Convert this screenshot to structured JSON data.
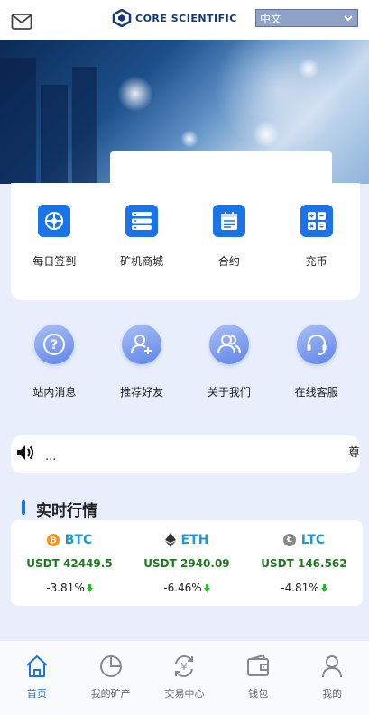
{
  "header": {
    "brand": "CORE SCIENTIFIC",
    "language": "中文",
    "icons": {
      "mail": "mail-icon",
      "logo": "core-scientific-logo"
    }
  },
  "quick_menu": [
    {
      "label": "每日签到",
      "icon": "sign-in-icon"
    },
    {
      "label": "矿机商城",
      "icon": "server-icon"
    },
    {
      "label": "合约",
      "icon": "contract-icon"
    },
    {
      "label": "充币",
      "icon": "calculator-icon"
    }
  ],
  "secondary_menu": [
    {
      "label": "站内消息",
      "icon": "question-icon"
    },
    {
      "label": "推荐好友",
      "icon": "add-user-icon"
    },
    {
      "label": "关于我们",
      "icon": "users-icon"
    },
    {
      "label": "在线客服",
      "icon": "headset-icon"
    }
  ],
  "notice": {
    "ellipsis": "...",
    "text": "尊敬"
  },
  "market": {
    "title": "实时行情",
    "coins": [
      {
        "symbol": "BTC",
        "price": "USDT 42449.5",
        "change": "-3.81%",
        "coin_color": "#f7931a",
        "icon": "bitcoin-icon"
      },
      {
        "symbol": "ETH",
        "price": "USDT 2940.09",
        "change": "-6.46%",
        "coin_color": "#333333",
        "icon": "ethereum-icon"
      },
      {
        "symbol": "LTC",
        "price": "USDT 146.562",
        "change": "-4.81%",
        "coin_color": "#888888",
        "icon": "litecoin-icon"
      }
    ]
  },
  "bottom_nav": [
    {
      "label": "首页",
      "icon": "home-icon",
      "active": true
    },
    {
      "label": "我的矿产",
      "icon": "pie-chart-icon",
      "active": false
    },
    {
      "label": "交易中心",
      "icon": "exchange-icon",
      "active": false
    },
    {
      "label": "钱包",
      "icon": "wallet-icon",
      "active": false
    },
    {
      "label": "我的",
      "icon": "user-icon",
      "active": false
    }
  ],
  "colors": {
    "accent": "#1a73e8",
    "price_green": "#1f7a1f",
    "symbol_blue": "#1a9ad6",
    "down_green": "#2eb82e"
  }
}
